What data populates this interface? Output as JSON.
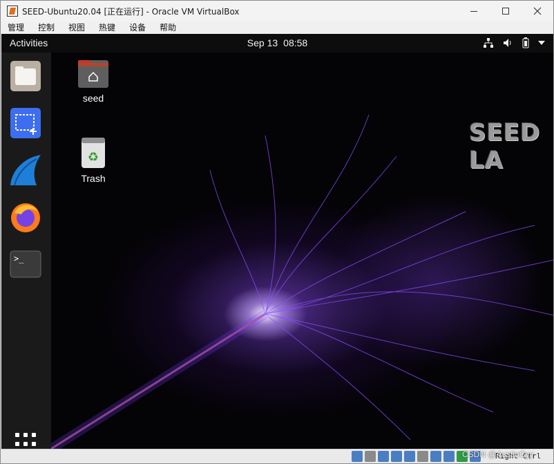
{
  "window": {
    "title": "SEED-Ubuntu20.04 [正在运行] - Oracle VM VirtualBox"
  },
  "menubar": {
    "items": [
      "管理",
      "控制",
      "视图",
      "热键",
      "设备",
      "帮助"
    ]
  },
  "topbar": {
    "activities": "Activities",
    "date": "Sep 13",
    "time": "08:58"
  },
  "tray_icons": [
    "network-icon",
    "volume-icon",
    "battery-icon",
    "system-menu-arrow-icon"
  ],
  "dock": {
    "items": [
      "files-icon",
      "screenshot-tool-icon",
      "wireshark-icon",
      "firefox-icon",
      "terminal-icon"
    ]
  },
  "desktop": {
    "icons": [
      {
        "label": "seed",
        "icon": "home-folder-icon"
      },
      {
        "label": "Trash",
        "icon": "trash-icon"
      }
    ],
    "logo_text": "SEED LA"
  },
  "statusbar": {
    "host_key": "Right Ctrl",
    "watermark": "CSDN @AustinCyy"
  },
  "colors": {
    "accent_purple": "#9b59ff",
    "folder_top": "#c0392b",
    "dock_bg": "#1a1a1a",
    "topbar_bg": "#0d0d0d"
  }
}
